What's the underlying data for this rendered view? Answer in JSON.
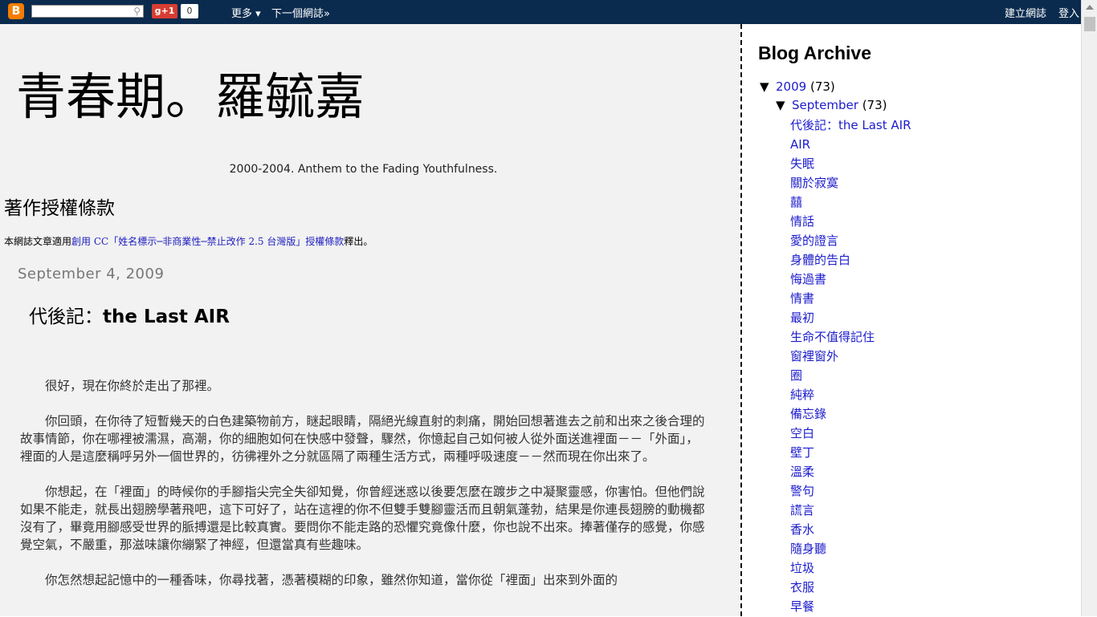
{
  "navbar": {
    "logo": "B",
    "gplus": "g+1",
    "gplus_count": "0",
    "more": "更多 ▾",
    "next_blog": "下一個網誌»",
    "create_blog": "建立網誌",
    "login": "登入"
  },
  "header": {
    "title": "青春期。羅毓嘉",
    "description": "2000-2004. Anthem to the Fading Youthfulness."
  },
  "license": {
    "title": "著作授權條款",
    "text_before": "本網誌文章適用",
    "link_text": "創用 CC「姓名標示─非商業性─禁止改作 2.5 台灣版」授權條款",
    "text_after": "釋出。"
  },
  "post": {
    "date": "September 4, 2009",
    "title_prefix": "代後記：",
    "title_main": "the Last AIR",
    "paragraphs": [
      "很好，現在你終於走出了那裡。",
      "你回頭，在你待了短暫幾天的白色建築物前方，瞇起眼睛，隔絕光線直射的刺痛，開始回想著進去之前和出來之後合理的故事情節，你在哪裡被濡濕，高潮，你的細胞如何在快感中發聲，驟然，你憶起自己如何被人從外面送進裡面－－「外面」，裡面的人是這麼稱呼另外一個世界的，彷彿裡外之分就區隔了兩種生活方式，兩種呼吸速度－－然而現在你出來了。",
      "你想起，在「裡面」的時候你的手腳指尖完全失卻知覺，你曾經迷惑以後要怎麼在踱步之中凝聚靈感，你害怕。但他們說如果不能走，就長出翅膀學著飛吧，這下可好了，站在這裡的你不但雙手雙腳靈活而且朝氣蓬勃，結果是你連長翅膀的動機都沒有了，畢竟用腳感受世界的脈搏還是比較真實。要問你不能走路的恐懼究竟像什麼，你也說不出來。捧著僅存的感覺，你感覺空氣，不嚴重，那滋味讓你繃緊了神經，但還當真有些趣味。",
      "你怎然想起記憶中的一種香味，你尋找著，憑著模糊的印象，雖然你知道，當你從「裡面」出來到外面的"
    ]
  },
  "sidebar": {
    "title": "Blog Archive",
    "year": {
      "toggle": "▼",
      "label": "2009",
      "count": "(73)"
    },
    "month": {
      "toggle": "▼",
      "label": "September",
      "count": "(73)"
    },
    "posts": [
      "代後記：the Last AIR",
      "AIR",
      "失眠",
      "關於寂寞",
      "囍",
      "情話",
      "愛的證言",
      "身體的告白",
      "悔過書",
      "情書",
      "最初",
      "生命不值得記住",
      "窗裡窗外",
      "圈",
      "純粹",
      "備忘錄",
      "空白",
      "壁丁",
      "溫柔",
      "警句",
      "謊言",
      "香水",
      "隨身聽",
      "垃圾",
      "衣服",
      "早餐"
    ]
  }
}
